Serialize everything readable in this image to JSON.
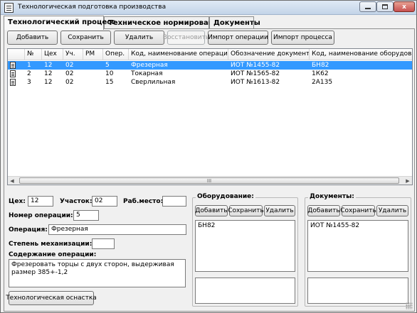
{
  "window": {
    "title": "Технологическая подготовка производства"
  },
  "tabs": [
    {
      "label": "Технологический процесс",
      "active": true
    },
    {
      "label": "Техническое нормирование",
      "active": false
    },
    {
      "label": "Документы",
      "active": false
    }
  ],
  "toolbar": {
    "add": "Добавить",
    "save": "Сохранить",
    "delete": "Удалить",
    "restore": "Восстановить",
    "import_operation": "Импорт операции",
    "import_process": "Импорт процесса"
  },
  "grid": {
    "columns": [
      "№",
      "Цех",
      "Уч.",
      "РМ",
      "Опер.",
      "Код, наименование операции",
      "Обозначение документа",
      "Код, наименование оборудования"
    ],
    "rows": [
      {
        "num": "1",
        "shop": "12",
        "section": "02",
        "workplace": "",
        "op": "5",
        "operation": "Фрезерная",
        "document": "ИОТ №1455-82",
        "equipment": "БН82",
        "selected": true
      },
      {
        "num": "2",
        "shop": "12",
        "section": "02",
        "workplace": "",
        "op": "10",
        "operation": "Токарная",
        "document": "ИОТ №1565-82",
        "equipment": "1К62",
        "selected": false
      },
      {
        "num": "3",
        "shop": "12",
        "section": "02",
        "workplace": "",
        "op": "15",
        "operation": "Сверлильная",
        "document": "ИОТ №1613-82",
        "equipment": "2А135",
        "selected": false
      }
    ],
    "scroll_thumb_glyph": "III"
  },
  "form": {
    "shop_label": "Цех:",
    "shop_value": "12",
    "section_label": "Участок:",
    "section_value": "02",
    "workplace_label": "Раб.место:",
    "workplace_value": "",
    "opnum_label": "Номер операции:",
    "opnum_value": "5",
    "operation_label": "Операция:",
    "operation_value": "Фрезерная",
    "mech_label": "Степень механизации:",
    "mech_value": "",
    "content_label": "Содержание операции:",
    "content_value": "Фрезеровать торцы с двух сторон, выдерживая размер 385+-1,2",
    "tooling_button": "Технологическая оснастка"
  },
  "equipment": {
    "title": "Оборудование:",
    "add": "Добавить",
    "save": "Сохранить",
    "delete": "Удалить",
    "list_value": "БН82"
  },
  "documents": {
    "title": "Документы:",
    "add": "Добавить",
    "save": "Сохранить",
    "delete": "Удалить",
    "list_value": "ИОТ №1455-82"
  },
  "window_controls": {
    "close_glyph": "x"
  }
}
